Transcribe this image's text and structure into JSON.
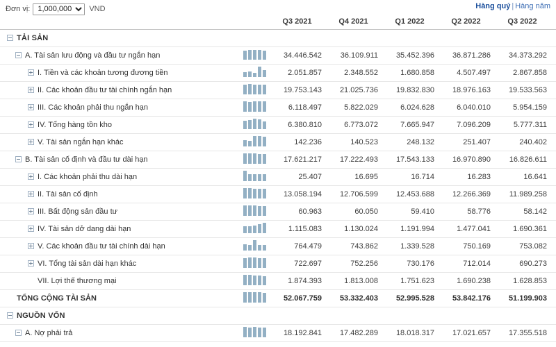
{
  "toolbar": {
    "unit_label": "Đơn vị:",
    "unit_value": "1,000,000",
    "unit_suffix": "VND",
    "unit_options": [
      "1,000,000"
    ],
    "period_quarterly": "Hàng quý",
    "period_separator": "|",
    "period_annual": "Hàng năm"
  },
  "colors": {
    "accent_link": "#1b4f9c",
    "link_inactive": "#3f6fb5",
    "sparkline_bar": "#93b0c4",
    "row_divider": "#e6e6e6",
    "header_divider": "#c8c8c8"
  },
  "table": {
    "columns": [
      "Q3 2021",
      "Q4 2021",
      "Q1 2022",
      "Q2 2022",
      "Q3 2022"
    ],
    "rows": [
      {
        "label": "TẢI SẢN",
        "toggle": "minus",
        "indent": 0,
        "style": "caps",
        "spark": null,
        "values": []
      },
      {
        "label": "A. Tài sản lưu động và đầu tư ngắn hạn",
        "toggle": "minus",
        "indent": 1,
        "style": "normal",
        "spark": [
          88,
          93,
          91,
          95,
          88
        ],
        "values": [
          "34.446.542",
          "36.109.911",
          "35.452.396",
          "36.871.286",
          "34.373.292"
        ]
      },
      {
        "label": "I. Tiền và các khoản tương đương tiền",
        "toggle": "plus",
        "indent": 2,
        "style": "normal",
        "spark": [
          46,
          52,
          37,
          100,
          64
        ],
        "values": [
          "2.051.857",
          "2.348.552",
          "1.680.858",
          "4.507.497",
          "2.867.858"
        ]
      },
      {
        "label": "II. Các khoản đầu tư tài chính ngắn hạn",
        "toggle": "plus",
        "indent": 2,
        "style": "normal",
        "spark": [
          94,
          100,
          94,
          90,
          93
        ],
        "values": [
          "19.753.143",
          "21.025.736",
          "19.832.830",
          "18.976.163",
          "19.533.563"
        ]
      },
      {
        "label": "III. Các khoản phải thu ngắn hạn",
        "toggle": "plus",
        "indent": 2,
        "style": "normal",
        "spark": [
          100,
          95,
          98,
          99,
          97
        ],
        "values": [
          "6.118.497",
          "5.822.029",
          "6.024.628",
          "6.040.010",
          "5.954.159"
        ]
      },
      {
        "label": "IV. Tổng hàng tồn kho",
        "toggle": "plus",
        "indent": 2,
        "style": "normal",
        "spark": [
          83,
          88,
          100,
          93,
          75
        ],
        "values": [
          "6.380.810",
          "6.773.072",
          "7.665.947",
          "7.096.209",
          "5.777.311"
        ]
      },
      {
        "label": "V. Tài sản ngắn hạn khác",
        "toggle": "plus",
        "indent": 2,
        "style": "normal",
        "spark": [
          57,
          56,
          99,
          100,
          96
        ],
        "values": [
          "142.236",
          "140.523",
          "248.132",
          "251.407",
          "240.402"
        ]
      },
      {
        "label": "B. Tài sản cố định và đầu tư dài hạn",
        "toggle": "minus",
        "indent": 1,
        "style": "normal",
        "spark": [
          100,
          98,
          100,
          96,
          95
        ],
        "values": [
          "17.621.217",
          "17.222.493",
          "17.543.133",
          "16.970.890",
          "16.826.611"
        ]
      },
      {
        "label": "I. Các khoản phải thu dài hạn",
        "toggle": "plus",
        "indent": 2,
        "style": "normal",
        "spark": [
          100,
          66,
          66,
          64,
          66
        ],
        "values": [
          "25.407",
          "16.695",
          "16.714",
          "16.283",
          "16.641"
        ]
      },
      {
        "label": "II. Tài sản cố định",
        "toggle": "plus",
        "indent": 2,
        "style": "normal",
        "spark": [
          100,
          97,
          95,
          94,
          92
        ],
        "values": [
          "13.058.194",
          "12.706.599",
          "12.453.688",
          "12.266.369",
          "11.989.258"
        ]
      },
      {
        "label": "III. Bất động sản đầu tư",
        "toggle": "plus",
        "indent": 2,
        "style": "normal",
        "spark": [
          100,
          99,
          97,
          96,
          95
        ],
        "values": [
          "60.963",
          "60.050",
          "59.410",
          "58.776",
          "58.142"
        ]
      },
      {
        "label": "IV. Tài sản dở dang dài hạn",
        "toggle": "plus",
        "indent": 2,
        "style": "normal",
        "spark": [
          66,
          67,
          70,
          87,
          100
        ],
        "values": [
          "1.115.083",
          "1.130.024",
          "1.191.994",
          "1.477.041",
          "1.690.361"
        ]
      },
      {
        "label": "V. Các khoản đầu tư tài chính dài hạn",
        "toggle": "plus",
        "indent": 2,
        "style": "normal",
        "spark": [
          57,
          55,
          100,
          56,
          56
        ],
        "values": [
          "764.479",
          "743.862",
          "1.339.528",
          "750.169",
          "753.082"
        ]
      },
      {
        "label": "VI. Tổng tài sản dài hạn khác",
        "toggle": "plus",
        "indent": 2,
        "style": "normal",
        "spark": [
          96,
          100,
          97,
          95,
          92
        ],
        "values": [
          "722.697",
          "752.256",
          "730.176",
          "712.014",
          "690.273"
        ]
      },
      {
        "label": "VII. Lợi thế thương mại",
        "toggle": "none",
        "indent": 2,
        "style": "normal",
        "spark": [
          100,
          97,
          93,
          90,
          87
        ],
        "values": [
          "1.874.393",
          "1.813.008",
          "1.751.623",
          "1.690.238",
          "1.628.853"
        ]
      },
      {
        "label": "TỔNG CỘNG TÀI SẢN",
        "toggle": "none",
        "indent": 0,
        "style": "bold",
        "spark": [
          97,
          99,
          98,
          100,
          95
        ],
        "values": [
          "52.067.759",
          "53.332.403",
          "52.995.528",
          "53.842.176",
          "51.199.903"
        ]
      },
      {
        "label": "NGUỒN VỐN",
        "toggle": "minus",
        "indent": 0,
        "style": "caps",
        "spark": null,
        "values": []
      },
      {
        "label": "A. Nợ phải trả",
        "toggle": "minus",
        "indent": 1,
        "style": "normal",
        "spark": [
          100,
          96,
          99,
          94,
          95
        ],
        "values": [
          "18.192.841",
          "17.482.289",
          "18.018.317",
          "17.021.657",
          "17.355.518"
        ]
      }
    ]
  }
}
